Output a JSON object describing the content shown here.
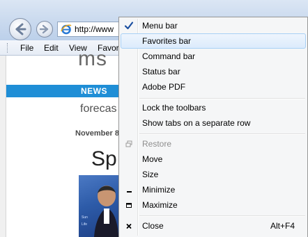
{
  "browser": {
    "address_text": "http://www",
    "menu_items": [
      "File",
      "Edit",
      "View",
      "Favor"
    ]
  },
  "page": {
    "logo_fragment": "ms",
    "news_label": "NEWS",
    "forecast_text": "forecas",
    "dateline": "November 8",
    "headline_fragment": "Sp"
  },
  "context_menu": {
    "items": [
      {
        "label": "Menu bar",
        "checked": true
      },
      {
        "label": "Favorites bar",
        "highlighted": true
      },
      {
        "label": "Command bar"
      },
      {
        "label": "Status bar"
      },
      {
        "label": "Adobe PDF"
      },
      {
        "label": "Lock the toolbars"
      },
      {
        "label": "Show tabs on a separate row"
      },
      {
        "label": "Restore",
        "disabled": true,
        "icon": "restore-icon"
      },
      {
        "label": "Move"
      },
      {
        "label": "Size"
      },
      {
        "label": "Minimize",
        "icon": "minimize-icon"
      },
      {
        "label": "Maximize",
        "icon": "maximize-icon"
      },
      {
        "label": "Close",
        "shortcut": "Alt+F4",
        "icon": "close-icon"
      }
    ]
  },
  "colors": {
    "news_band": "#1f8ed6",
    "menu_highlight_border": "#a8d0f6",
    "checkmark": "#1b4fa0"
  }
}
